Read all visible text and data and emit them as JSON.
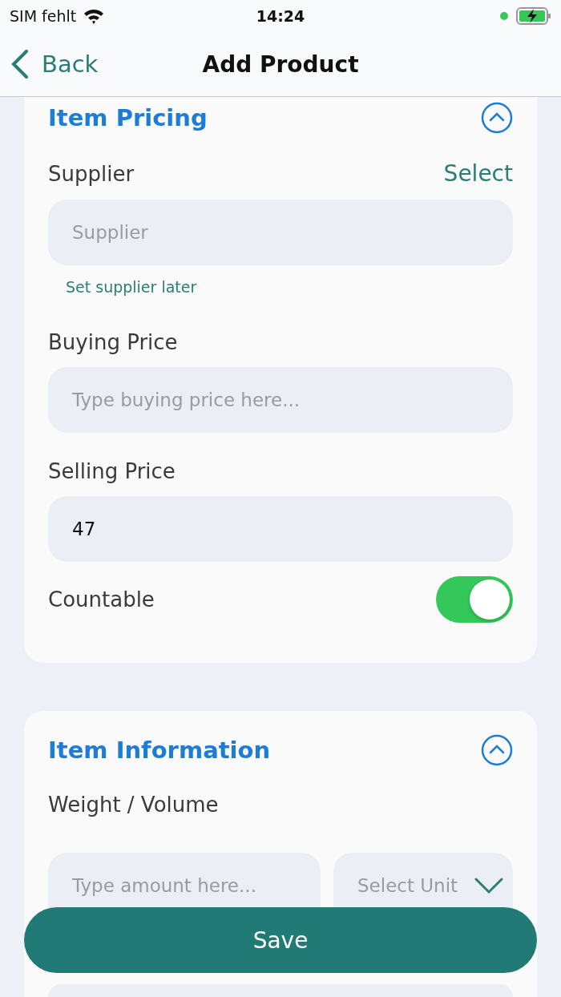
{
  "status_bar": {
    "carrier": "SIM fehlt",
    "time": "14:24"
  },
  "nav": {
    "back": "Back",
    "title": "Add Product"
  },
  "sections": [
    {
      "title": "Item Pricing",
      "expanded": true,
      "rows": [
        {
          "kind": "field",
          "label": "Supplier",
          "action": "Select",
          "placeholder": "Supplier",
          "link": "Set supplier later"
        },
        {
          "kind": "field",
          "label": "Buying Price",
          "placeholder": "Type buying price here..."
        },
        {
          "kind": "field",
          "label": "Selling Price",
          "value": "47"
        },
        {
          "kind": "toggle",
          "label": "Countable",
          "on": true
        }
      ]
    },
    {
      "title": "Item Information",
      "expanded": true,
      "rows": [
        {
          "kind": "split",
          "label": "Weight / Volume",
          "placeholder": "Type amount here...",
          "select": "Select Unit"
        },
        {
          "kind": "blank"
        }
      ]
    }
  ],
  "save": "Save"
}
